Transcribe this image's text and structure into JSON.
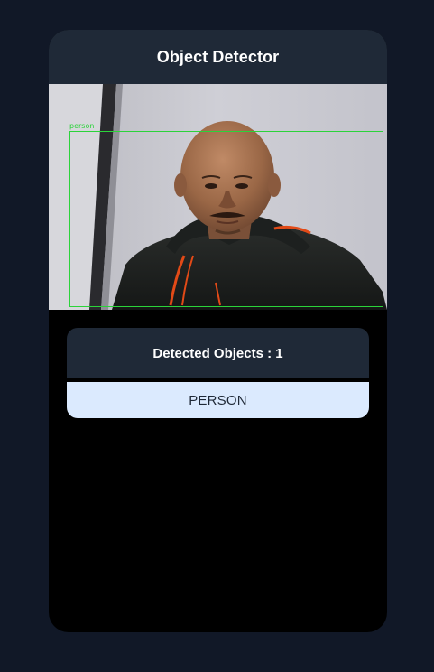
{
  "app": {
    "title": "Object Detector"
  },
  "camera": {
    "detections": [
      {
        "label": "person"
      }
    ],
    "box_color": "#2bd33a"
  },
  "results": {
    "header_label": "Detected Objects : ",
    "count": "1",
    "items": [
      {
        "label": "PERSON"
      }
    ]
  },
  "colors": {
    "page_background": "#111827",
    "header_background": "#1f2937",
    "item_background": "#dbeafe",
    "app_background": "#000000"
  }
}
